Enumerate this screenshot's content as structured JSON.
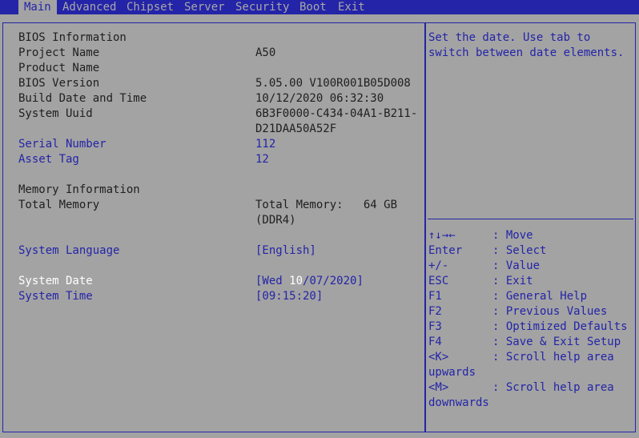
{
  "tabs": [
    "Main",
    "Advanced",
    "Chipset",
    "Server",
    "Security",
    "Boot",
    "Exit"
  ],
  "bios_info": {
    "heading": "BIOS Information",
    "project_label": "Project Name",
    "project_value": "A50",
    "product_label": "Product Name",
    "product_value": "",
    "version_label": "BIOS Version",
    "version_value": "5.05.00 V100R001B05D008",
    "build_label": "Build Date and Time",
    "build_value": "10/12/2020 06:32:30",
    "uuid_label": "System Uuid",
    "uuid_line1": "6B3F0000-C434-04A1-B211-",
    "uuid_line2": "D21DAA50A52F",
    "serial_label": "Serial Number",
    "serial_value": "112",
    "asset_label": "Asset Tag",
    "asset_value": "12"
  },
  "memory": {
    "heading": "Memory Information",
    "total_label": "Total Memory",
    "total_value_line1": "Total Memory:   64 GB",
    "total_value_line2": "(DDR4)"
  },
  "settings": {
    "language_label": "System Language",
    "language_value": "[English]",
    "date_label": "System Date",
    "date_prefix": "[Wed ",
    "date_highlight": "10",
    "date_suffix": "/07/2020]",
    "time_label": "System Time",
    "time_value": "[09:15:20]"
  },
  "help_text": "Set the date. Use tab to\nswitch between date elements.",
  "keys": [
    {
      "key": "↑↓→←",
      "desc": "Move"
    },
    {
      "key": "Enter",
      "desc": "Select"
    },
    {
      "key": "+/-",
      "desc": "Value"
    },
    {
      "key": "ESC",
      "desc": "Exit"
    },
    {
      "key": "F1",
      "desc": "General Help"
    },
    {
      "key": "F2",
      "desc": "Previous Values"
    },
    {
      "key": "F3",
      "desc": "Optimized Defaults"
    },
    {
      "key": "F4",
      "desc": "Save & Exit Setup"
    },
    {
      "key": "<K>",
      "desc": "Scroll help area"
    },
    {
      "key": "upwards",
      "desc": ""
    },
    {
      "key": "<M>",
      "desc": "Scroll help area"
    },
    {
      "key": "downwards",
      "desc": ""
    }
  ],
  "colors": {
    "frame": "#2424a8",
    "background": "#a3a3a3",
    "text": "#202020",
    "highlight": "#ffffff"
  }
}
